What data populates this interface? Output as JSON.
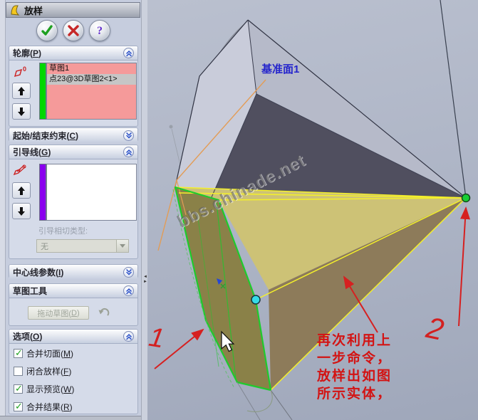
{
  "panel": {
    "title": "放样",
    "toolbar": {
      "ok_icon": "green-check",
      "cancel_icon": "red-x",
      "help_icon": "purple-question"
    },
    "sections": {
      "profile": {
        "label": "轮廓(P)",
        "items": [
          {
            "text": "草图1",
            "selected": false
          },
          {
            "text": "点23@3D草图2<1>",
            "selected": true
          }
        ]
      },
      "start_end": {
        "label": "起始/结束约束(C)"
      },
      "guide": {
        "label": "引导线(G)",
        "tangency_label": "引导相切类型:",
        "tangency_value": "无"
      },
      "centerline": {
        "label": "中心线参数(I)"
      },
      "sketch_tools": {
        "label": "草图工具",
        "drag_button": "拖动草图(D)"
      },
      "options": {
        "label": "选项(O)",
        "checkboxes": [
          {
            "label": "合并切面(M)",
            "checked": true
          },
          {
            "label": "闭合放样(F)",
            "checked": false
          },
          {
            "label": "显示预览(W)",
            "checked": true
          },
          {
            "label": "合并结果(R)",
            "checked": true
          }
        ]
      }
    }
  },
  "viewport": {
    "plane_label": "基准面1",
    "watermark": "bbs.chinade.net",
    "annotation": {
      "lines": [
        "再次利用上",
        "一步命令，",
        "放样出如图",
        "所示实体，"
      ]
    },
    "markers": {
      "step1": "1",
      "step2": "2"
    },
    "colors": {
      "profile_list_bg": "#f59a9a",
      "selected_row": "#c6c6c6",
      "profile_bar_green": "#00d800",
      "guide_bar_purple": "#8a00ee",
      "preview_line_yellow": "#f4f02b",
      "selected_edge_green": "#1ecb2d",
      "annotation_red": "#d31313",
      "plane_label_blue": "#2525cc",
      "face_khaki": "#cdc276",
      "face_brown": "#8d7b5a",
      "face_olive": "#8a8148",
      "face_navy": "#504f5f",
      "face_light": "#c9ccda",
      "vertex_point_green": "#18cf35",
      "vertex_point_cyan": "#35dbe8"
    }
  }
}
